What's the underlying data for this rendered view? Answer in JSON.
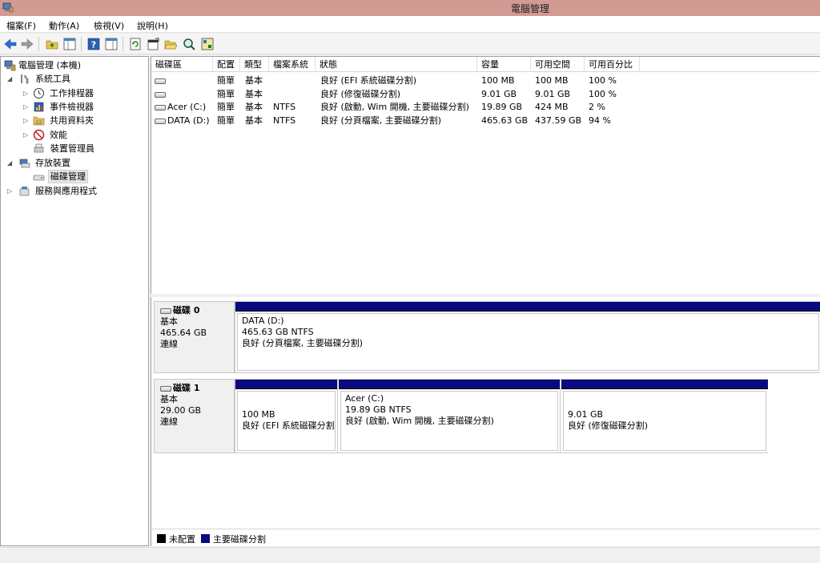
{
  "window": {
    "title": "電腦管理"
  },
  "menu": [
    "檔案(F)",
    "動作(A)",
    "檢視(V)",
    "說明(H)"
  ],
  "tree": {
    "root": "電腦管理 (本機)",
    "system_tools": "系統工具",
    "task_scheduler": "工作排程器",
    "event_viewer": "事件檢視器",
    "shared_folders": "共用資料夾",
    "performance": "效能",
    "device_manager": "裝置管理員",
    "storage": "存放裝置",
    "disk_management": "磁碟管理",
    "services_apps": "服務與應用程式"
  },
  "volume_columns": [
    "磁碟區",
    "配置",
    "類型",
    "檔案系統",
    "狀態",
    "容量",
    "可用空間",
    "可用百分比"
  ],
  "volumes": [
    {
      "name": "",
      "layout": "簡單",
      "type": "基本",
      "fs": "",
      "status": "良好 (EFI 系統磁碟分割)",
      "capacity": "100 MB",
      "free": "100 MB",
      "pct": "100 %"
    },
    {
      "name": "",
      "layout": "簡單",
      "type": "基本",
      "fs": "",
      "status": "良好 (修復磁碟分割)",
      "capacity": "9.01 GB",
      "free": "9.01 GB",
      "pct": "100 %"
    },
    {
      "name": "Acer (C:)",
      "layout": "簡單",
      "type": "基本",
      "fs": "NTFS",
      "status": "良好 (啟動, Wim 開機, 主要磁碟分割)",
      "capacity": "19.89 GB",
      "free": "424 MB",
      "pct": "2 %"
    },
    {
      "name": "DATA (D:)",
      "layout": "簡單",
      "type": "基本",
      "fs": "NTFS",
      "status": "良好 (分頁檔案, 主要磁碟分割)",
      "capacity": "465.63 GB",
      "free": "437.59 GB",
      "pct": "94 %"
    }
  ],
  "disks": [
    {
      "name": "磁碟 0",
      "type": "基本",
      "size": "465.64 GB",
      "state": "連線",
      "partitions": [
        {
          "name": "DATA  (D:)",
          "size": "465.63 GB NTFS",
          "status": "良好 (分頁檔案, 主要磁碟分割)"
        }
      ]
    },
    {
      "name": "磁碟 1",
      "type": "基本",
      "size": "29.00 GB",
      "state": "連線",
      "partitions": [
        {
          "name": "",
          "size": "100 MB",
          "status": "良好 (EFI 系統磁碟分割)"
        },
        {
          "name": "Acer  (C:)",
          "size": "19.89 GB NTFS",
          "status": "良好 (啟動, Wim 開機, 主要磁碟分割)"
        },
        {
          "name": "",
          "size": "9.01 GB",
          "status": "良好 (修復磁碟分割)"
        }
      ]
    }
  ],
  "legend": {
    "unallocated": "未配置",
    "primary": "主要磁碟分割"
  },
  "colors": {
    "partition_bar": "#0a0a80",
    "titlebar": "#d29a92"
  }
}
